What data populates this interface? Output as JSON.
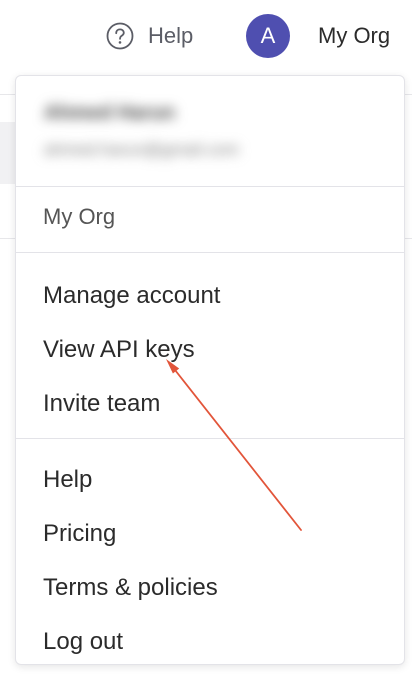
{
  "header": {
    "help_icon": "question-circle-icon",
    "help_label": "Help",
    "avatar_initial": "A",
    "org_name": "My Org"
  },
  "dropdown": {
    "user": {
      "name": "Ahmed Harun",
      "email": "ahmed.harun@gmail.com",
      "redacted": true
    },
    "organization": "My Org",
    "account_section": [
      "Manage account",
      "View API keys",
      "Invite team"
    ],
    "support_section": [
      "Help",
      "Pricing",
      "Terms & policies",
      "Log out"
    ]
  },
  "annotation": {
    "type": "arrow",
    "color": "#e2553a",
    "target": "View API keys"
  },
  "colors": {
    "avatar_bg": "#4f4fb0",
    "divider": "#e3e3e8",
    "text": "#2b2b2b",
    "muted_text": "#5b5d66"
  }
}
